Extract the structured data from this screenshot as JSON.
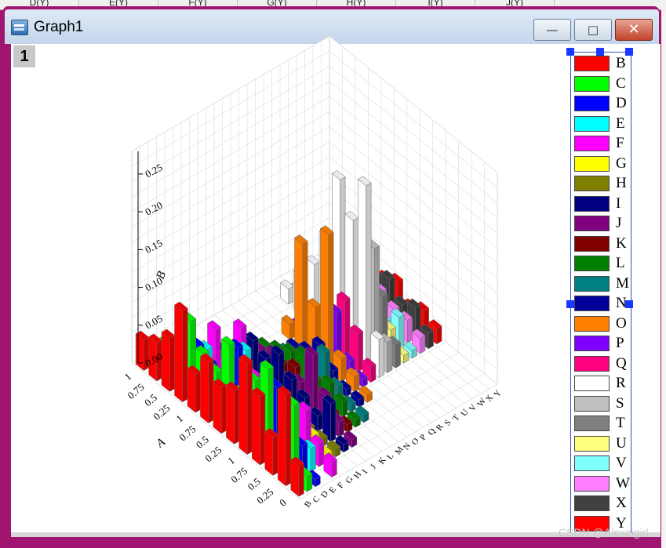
{
  "spreadsheet": {
    "column_headers": [
      "D(Y)",
      "E(Y)",
      "F(Y)",
      "G(Y)",
      "H(Y)",
      "I(Y)",
      "J(Y)"
    ]
  },
  "window": {
    "title": "Graph1",
    "layer_label": "1",
    "buttons": {
      "minimize": "—",
      "maximize": "□",
      "close": "✕"
    }
  },
  "chart_data": {
    "type": "bar3d",
    "x_axis_label": "A",
    "y_axis_label": "B",
    "x_tick_labels": [
      "0",
      "0.25",
      "0.5",
      "0.75",
      "1",
      "0.25",
      "0.5",
      "0.75",
      "1",
      "0.25",
      "0.5",
      "0.75",
      "1"
    ],
    "z_tick_labels": [
      "0.00",
      "0.05",
      "0.10",
      "0.15",
      "0.20",
      "0.25"
    ],
    "zlim": [
      0,
      0.28
    ],
    "series": [
      {
        "name": "B",
        "color": "#ff0000",
        "values": [
          0.04,
          0.12,
          0.05,
          0.09,
          0.12,
          0.07,
          0.06,
          0.08,
          0.05,
          0.12,
          0.07,
          0.05,
          0.04
        ]
      },
      {
        "name": "C",
        "color": "#00ff00",
        "values": [
          0.02,
          0.1,
          0.03,
          0.12,
          0.09,
          0.06,
          0.11,
          0.06,
          0.07,
          0.1,
          0.05,
          0.04,
          0.02
        ]
      },
      {
        "name": "D",
        "color": "#0000ff",
        "values": [
          0.01,
          0.04,
          0.02,
          0.09,
          0.05,
          0.03,
          0.1,
          0.04,
          0.05,
          0.06,
          0.02,
          0.01,
          0.0
        ]
      },
      {
        "name": "E",
        "color": "#00ffff",
        "values": [
          0.0,
          0.03,
          0.01,
          0.04,
          0.02,
          0.05,
          0.09,
          0.05,
          0.03,
          0.05,
          0.02,
          0.01,
          0.0
        ]
      },
      {
        "name": "F",
        "color": "#ff00ff",
        "values": [
          0.02,
          0.03,
          0.06,
          0.02,
          0.03,
          0.06,
          0.05,
          0.1,
          0.04,
          0.07,
          0.03,
          0.02,
          0.01
        ]
      },
      {
        "name": "G",
        "color": "#ffff00",
        "values": [
          0.0,
          0.01,
          0.02,
          0.01,
          0.03,
          0.02,
          0.01,
          0.02,
          0.0,
          0.01,
          0.01,
          0.0,
          0.0
        ]
      },
      {
        "name": "H",
        "color": "#808000",
        "values": [
          0.0,
          0.01,
          0.01,
          0.01,
          0.02,
          0.01,
          0.0,
          0.01,
          0.0,
          0.02,
          0.01,
          0.0,
          0.0
        ]
      },
      {
        "name": "I",
        "color": "#000080",
        "values": [
          0.0,
          0.01,
          0.05,
          0.02,
          0.03,
          0.04,
          0.06,
          0.04,
          0.05,
          0.03,
          0.01,
          0.0,
          0.0
        ]
      },
      {
        "name": "J",
        "color": "#800080",
        "values": [
          0.0,
          0.01,
          0.02,
          0.04,
          0.08,
          0.03,
          0.02,
          0.04,
          0.03,
          0.01,
          0.0,
          0.0,
          0.0
        ]
      },
      {
        "name": "K",
        "color": "#800000",
        "values": [
          0.0,
          0.0,
          0.01,
          0.01,
          0.02,
          0.01,
          0.03,
          0.02,
          0.01,
          0.0,
          0.0,
          0.0,
          0.0
        ]
      },
      {
        "name": "L",
        "color": "#008000",
        "values": [
          0.0,
          0.0,
          0.01,
          0.02,
          0.03,
          0.02,
          0.04,
          0.03,
          0.02,
          0.01,
          0.0,
          0.0,
          0.0
        ]
      },
      {
        "name": "M",
        "color": "#008080",
        "values": [
          0.0,
          0.0,
          0.01,
          0.01,
          0.02,
          0.05,
          0.02,
          0.01,
          0.01,
          0.0,
          0.0,
          0.0,
          0.0
        ]
      },
      {
        "name": "N",
        "color": "#000099",
        "values": [
          0.0,
          0.0,
          0.0,
          0.01,
          0.01,
          0.02,
          0.04,
          0.02,
          0.01,
          0.0,
          0.0,
          0.0,
          0.0
        ]
      },
      {
        "name": "O",
        "color": "#ff8000",
        "values": [
          0.0,
          0.0,
          0.0,
          0.01,
          0.02,
          0.03,
          0.18,
          0.07,
          0.14,
          0.02,
          0.0,
          0.0,
          0.0
        ]
      },
      {
        "name": "P",
        "color": "#8000ff",
        "values": [
          0.0,
          0.0,
          0.0,
          0.0,
          0.01,
          0.02,
          0.07,
          0.04,
          0.02,
          0.01,
          0.0,
          0.0,
          0.0
        ]
      },
      {
        "name": "Q",
        "color": "#ff0080",
        "values": [
          0.0,
          0.0,
          0.0,
          0.0,
          0.02,
          0.05,
          0.08,
          0.05,
          0.03,
          0.01,
          0.0,
          0.0,
          0.0
        ]
      },
      {
        "name": "R",
        "color": "#ffffff",
        "values": [
          0.0,
          0.0,
          0.0,
          0.0,
          0.05,
          0.24,
          0.18,
          0.22,
          0.13,
          0.08,
          0.05,
          0.02,
          0.0
        ]
      },
      {
        "name": "S",
        "color": "#c0c0c0",
        "values": [
          0.0,
          0.0,
          0.0,
          0.0,
          0.04,
          0.15,
          0.1,
          0.11,
          0.08,
          0.04,
          0.02,
          0.01,
          0.0
        ]
      },
      {
        "name": "T",
        "color": "#808080",
        "values": [
          0.0,
          0.0,
          0.0,
          0.0,
          0.03,
          0.08,
          0.05,
          0.06,
          0.05,
          0.03,
          0.02,
          0.01,
          0.0
        ]
      },
      {
        "name": "U",
        "color": "#ffff80",
        "values": [
          0.0,
          0.0,
          0.0,
          0.0,
          0.01,
          0.03,
          0.02,
          0.03,
          0.02,
          0.01,
          0.01,
          0.0,
          0.0
        ]
      },
      {
        "name": "V",
        "color": "#80ffff",
        "values": [
          0.0,
          0.0,
          0.0,
          0.0,
          0.01,
          0.04,
          0.02,
          0.03,
          0.02,
          0.01,
          0.01,
          0.0,
          0.0
        ]
      },
      {
        "name": "W",
        "color": "#ff80ff",
        "values": [
          0.0,
          0.0,
          0.0,
          0.0,
          0.02,
          0.03,
          0.03,
          0.04,
          0.03,
          0.02,
          0.01,
          0.0,
          0.0
        ]
      },
      {
        "name": "X",
        "color": "#404040",
        "values": [
          0.0,
          0.0,
          0.0,
          0.0,
          0.02,
          0.04,
          0.03,
          0.05,
          0.04,
          0.02,
          0.01,
          0.0,
          0.0
        ]
      },
      {
        "name": "Y",
        "color": "#ff0000",
        "values": [
          0.0,
          0.0,
          0.0,
          0.0,
          0.02,
          0.03,
          0.02,
          0.04,
          0.03,
          0.02,
          0.01,
          0.0,
          0.0
        ]
      }
    ]
  },
  "watermark": "CSDN @Alexeigirl"
}
